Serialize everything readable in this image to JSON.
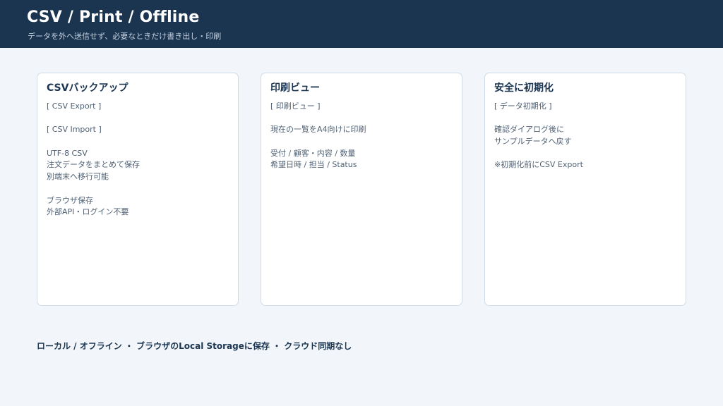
{
  "header": {
    "title": "CSV / Print / Offline",
    "subtitle": "データを外へ送信せず、必要なときだけ書き出し・印刷"
  },
  "cards": [
    {
      "title": "CSVバックアップ",
      "lines": [
        "[ CSV Export ]",
        "",
        "[ CSV Import ]",
        "",
        "UTF-8 CSV",
        "注文データをまとめて保存",
        "別端末へ移行可能",
        "",
        "ブラウザ保存",
        "外部API・ログイン不要"
      ]
    },
    {
      "title": "印刷ビュー",
      "lines": [
        "[ 印刷ビュー ]",
        "",
        "現在の一覧をA4向けに印刷",
        "",
        "受付 / 顧客・内容 / 数量",
        "希望日時 / 担当 / Status"
      ]
    },
    {
      "title": "安全に初期化",
      "lines": [
        "[ データ初期化 ]",
        "",
        "確認ダイアログ後に",
        "サンプルデータへ戻す",
        "",
        "※初期化前にCSV Export"
      ]
    }
  ],
  "footer": {
    "text": "ローカル / オフライン ・ ブラウザのLocal Storageに保存 ・ クラウド同期なし"
  }
}
